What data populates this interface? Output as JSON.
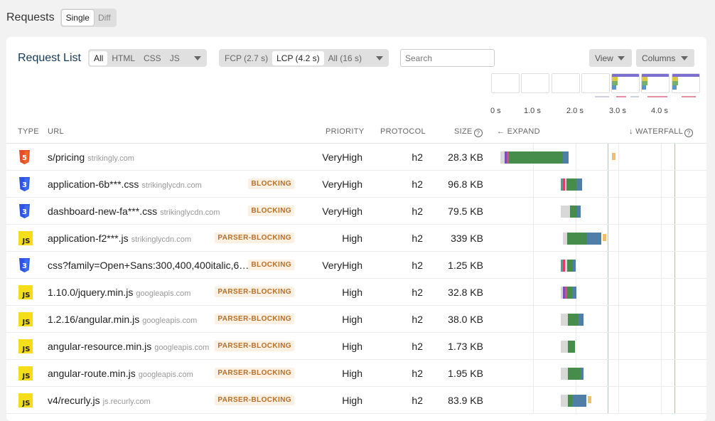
{
  "page": {
    "title": "Requests",
    "mode_options": [
      {
        "label": "Single",
        "active": true
      },
      {
        "label": "Diff",
        "active": false
      }
    ]
  },
  "card": {
    "title": "Request List",
    "type_filters": [
      {
        "label": "All",
        "active": true
      },
      {
        "label": "HTML",
        "active": false
      },
      {
        "label": "CSS",
        "active": false
      },
      {
        "label": "JS",
        "active": false
      }
    ],
    "time_filters": [
      {
        "label": "FCP (2.7 s)",
        "active": false
      },
      {
        "label": "LCP (4.2 s)",
        "active": true
      },
      {
        "label": "All (16 s)",
        "active": false
      }
    ],
    "search": {
      "placeholder": "Search",
      "value": ""
    },
    "view_label": "View",
    "columns_label": "Columns"
  },
  "timeline": {
    "labels": [
      "0 s",
      "1.0 s",
      "2.0 s",
      "3.0 s",
      "4.0 s"
    ]
  },
  "headers": {
    "type": "TYPE",
    "url": "URL",
    "priority": "PRIORITY",
    "protocol": "PROTOCOL",
    "size": "SIZE",
    "expand": "EXPAND",
    "waterfall": "WATERFALL"
  },
  "colors": {
    "html": "#e44d26",
    "css": "#2d53e5",
    "js": "#f5de19",
    "badge_text": "#b5702b",
    "title": "#123a5a"
  },
  "rows": [
    {
      "type": "html",
      "url": "s/pricing",
      "domain": "strikingly.com",
      "badge": "",
      "priority": "VeryHigh",
      "protocol": "h2",
      "size": "28.3 KB"
    },
    {
      "type": "css",
      "url": "application-6b***.css",
      "domain": "strikinglycdn.com",
      "badge": "BLOCKING",
      "priority": "VeryHigh",
      "protocol": "h2",
      "size": "96.8 KB"
    },
    {
      "type": "css",
      "url": "dashboard-new-fa***.css",
      "domain": "strikinglycdn.com",
      "badge": "BLOCKING",
      "priority": "VeryHigh",
      "protocol": "h2",
      "size": "79.5 KB"
    },
    {
      "type": "js",
      "url": "application-f2***.js",
      "domain": "strikinglycdn.com",
      "badge": "PARSER-BLOCKING",
      "priority": "High",
      "protocol": "h2",
      "size": "339 KB"
    },
    {
      "type": "css",
      "url": "css?family=Open+Sans:300,400,400italic,6…",
      "domain": "",
      "badge": "BLOCKING",
      "priority": "VeryHigh",
      "protocol": "h2",
      "size": "1.25 KB"
    },
    {
      "type": "js",
      "url": "1.10.0/jquery.min.js",
      "domain": "googleapis.com",
      "badge": "PARSER-BLOCKING",
      "priority": "High",
      "protocol": "h2",
      "size": "32.8 KB"
    },
    {
      "type": "js",
      "url": "1.2.16/angular.min.js",
      "domain": "googleapis.com",
      "badge": "PARSER-BLOCKING",
      "priority": "High",
      "protocol": "h2",
      "size": "38.0 KB"
    },
    {
      "type": "js",
      "url": "angular-resource.min.js",
      "domain": "googleapis.com",
      "badge": "PARSER-BLOCKING",
      "priority": "High",
      "protocol": "h2",
      "size": "1.73 KB"
    },
    {
      "type": "js",
      "url": "angular-route.min.js",
      "domain": "googleapis.com",
      "badge": "PARSER-BLOCKING",
      "priority": "High",
      "protocol": "h2",
      "size": "1.95 KB"
    },
    {
      "type": "js",
      "url": "v4/recurly.js",
      "domain": "js.recurly.com",
      "badge": "PARSER-BLOCKING",
      "priority": "High",
      "protocol": "h2",
      "size": "83.9 KB"
    }
  ]
}
